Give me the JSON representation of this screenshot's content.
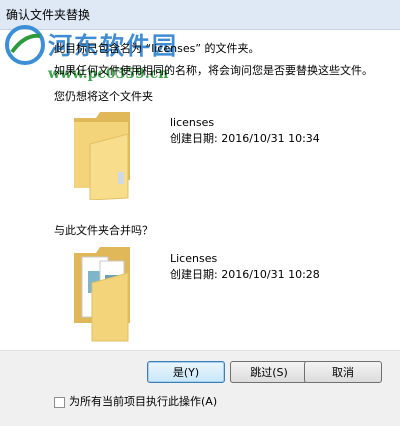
{
  "window": {
    "title": "确认文件夹替换"
  },
  "watermark": {
    "text": "河东软件园",
    "url": "www.pc0359.cn"
  },
  "message": {
    "line1": "此目标已包含名为 “licenses” 的文件夹。",
    "line2": "如果任何文件使用相同的名称，将会询问您是否要替换这些文件。"
  },
  "existing": {
    "label": "您仍想将这个文件夹",
    "name": "licenses",
    "date": "创建日期: 2016/10/31 10:34"
  },
  "incoming": {
    "label": "与此文件夹合并吗？",
    "name": "Licenses",
    "date": "创建日期: 2016/10/31 10:28"
  },
  "buttons": {
    "yes": "是(Y)",
    "skip": "跳过(S)",
    "cancel": "取消"
  },
  "checkbox": {
    "label": "为所有当前项目执行此操作(A)",
    "checked": false
  }
}
